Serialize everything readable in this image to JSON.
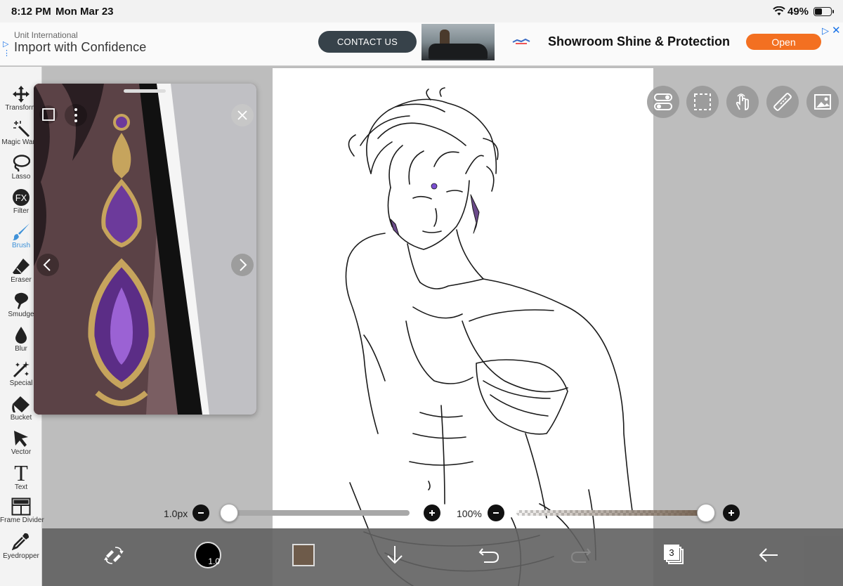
{
  "status_bar": {
    "time": "8:12 PM",
    "date": "Mon Mar 23",
    "battery": "49%",
    "battery_level": 0.49
  },
  "ad": {
    "company": "Unit International",
    "headline": "Import with Confidence",
    "cta": "CONTACT US",
    "secondary_headline": "Showroom Shine & Protection",
    "open_label": "Open",
    "ad_choices_icon": "ad-choices-icon",
    "close_icon": "close-icon",
    "accent_color": "#f37021",
    "cta_color": "#37424a"
  },
  "toolbar": {
    "items": [
      {
        "label": "Transform",
        "icon": "move-arrows-icon"
      },
      {
        "label": "Magic Wand",
        "icon": "magic-wand-icon"
      },
      {
        "label": "Lasso",
        "icon": "lasso-icon"
      },
      {
        "label": "Filter",
        "icon": "fx-icon",
        "glyph": "FX"
      },
      {
        "label": "Brush",
        "icon": "brush-icon",
        "active": true
      },
      {
        "label": "Eraser",
        "icon": "eraser-icon"
      },
      {
        "label": "Smudge",
        "icon": "smudge-icon"
      },
      {
        "label": "Blur",
        "icon": "drop-icon"
      },
      {
        "label": "Special",
        "icon": "sparkle-wand-icon"
      },
      {
        "label": "Bucket",
        "icon": "bucket-icon"
      },
      {
        "label": "Vector",
        "icon": "cursor-arrow-icon"
      },
      {
        "label": "Text",
        "icon": "text-icon",
        "glyph": "T"
      },
      {
        "label": "Frame Divider",
        "icon": "frame-divider-icon"
      },
      {
        "label": "Eyedropper",
        "icon": "eyedropper-icon"
      }
    ],
    "active_color": "#3f92d8"
  },
  "reference_window": {
    "icons": [
      "reference-frame-icon",
      "more-options-icon",
      "close-icon",
      "chevron-left-icon",
      "chevron-right-icon"
    ]
  },
  "canvas_quick_buttons": [
    "toggle-icon",
    "selection-icon",
    "touch-hand-icon",
    "ruler-icon",
    "image-icon"
  ],
  "sliders": {
    "brush_size": {
      "value": "1.0px",
      "level": 0.0
    },
    "opacity": {
      "value": "100%",
      "level": 1.0
    }
  },
  "bottom_bar": {
    "brush_size_badge": "1.0",
    "layer_count": "3",
    "current_color": "#6e5b4a",
    "icons": [
      "swap-tools-icon",
      "brush-size-icon",
      "color-swatch-icon",
      "download-icon",
      "undo-icon",
      "redo-icon",
      "layers-icon",
      "back-arrow-icon"
    ]
  }
}
